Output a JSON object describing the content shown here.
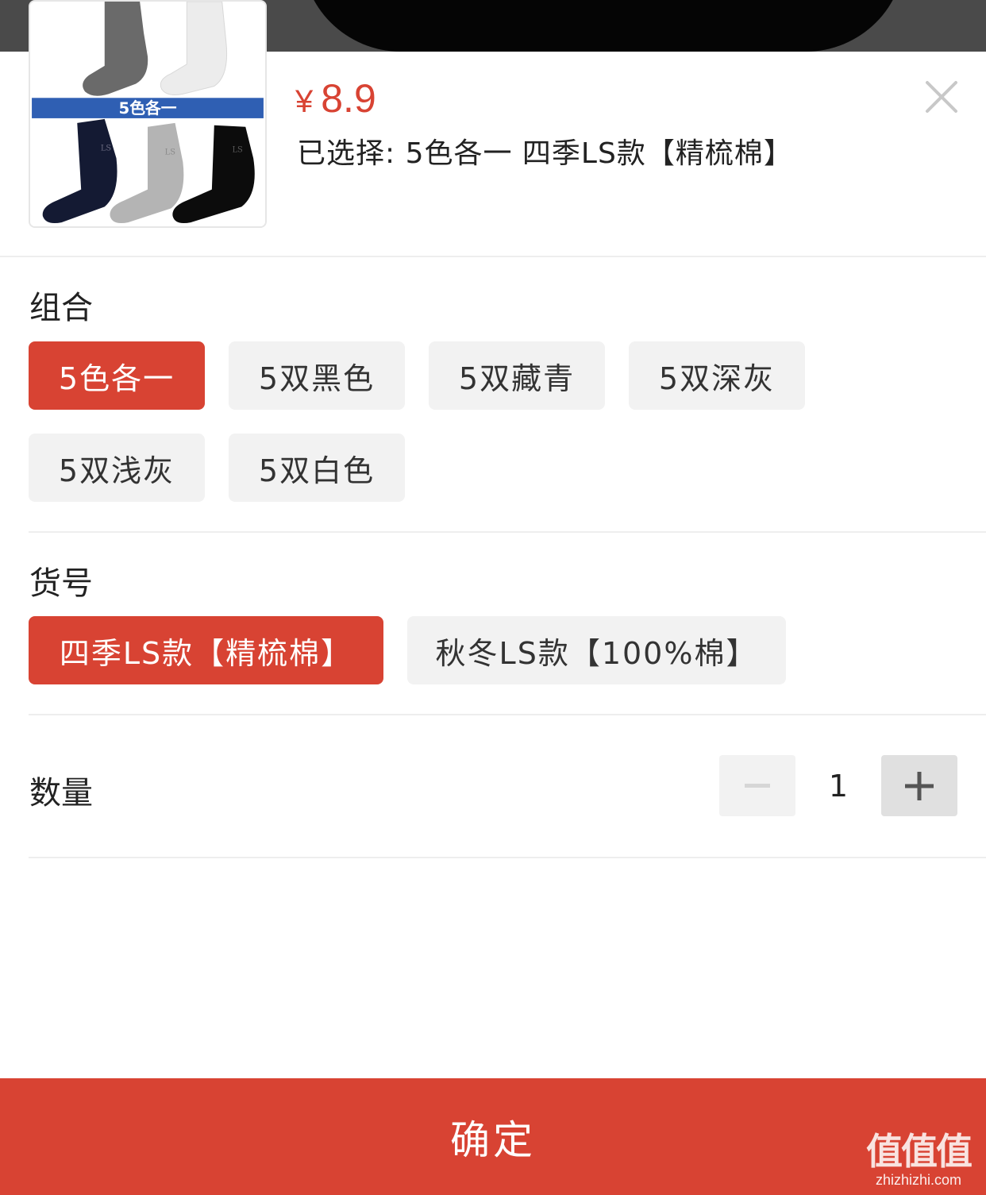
{
  "product": {
    "image_banner": "5色各一",
    "image_sock_mark": "LS",
    "price_currency": "¥",
    "price_value": "8.9",
    "selected_text": "已选择: 5色各一 四季LS款【精梳棉】"
  },
  "combo": {
    "label": "组合",
    "options": [
      "5色各一",
      "5双黑色",
      "5双藏青",
      "5双深灰",
      "5双浅灰",
      "5双白色"
    ],
    "selected": "5色各一"
  },
  "item_no": {
    "label": "货号",
    "options": [
      "四季LS款【精梳棉】",
      "秋冬LS款【100%棉】"
    ],
    "selected": "四季LS款【精梳棉】"
  },
  "quantity": {
    "label": "数量",
    "value": "1"
  },
  "confirm_label": "确定",
  "watermark": {
    "logo": "值值值",
    "url": "zhizhizhi.com"
  },
  "colors": {
    "accent": "#d84333",
    "chip_bg": "#f2f2f2"
  },
  "icons": [
    "close-icon",
    "minus-icon",
    "plus-icon"
  ]
}
